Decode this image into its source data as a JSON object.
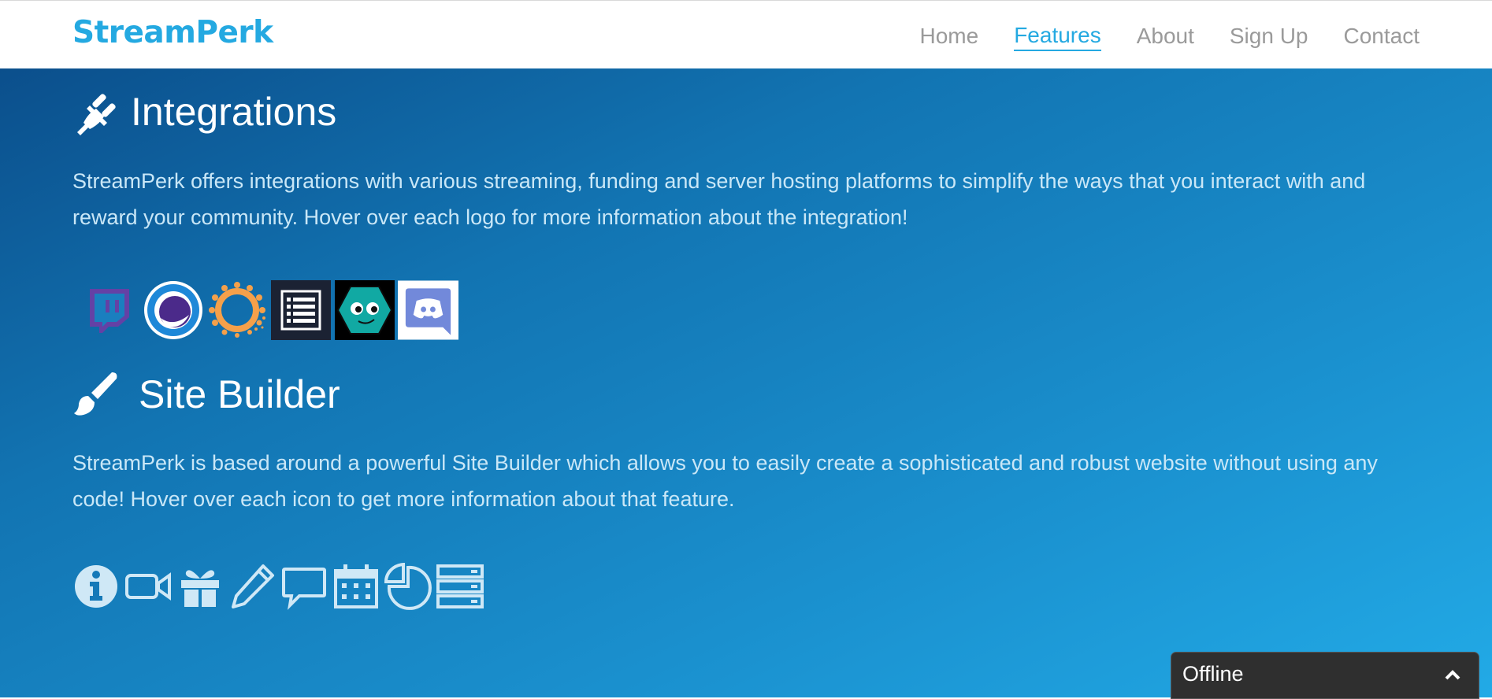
{
  "brand": "StreamPerk",
  "nav": {
    "items": [
      {
        "label": "Home"
      },
      {
        "label": "Features"
      },
      {
        "label": "About"
      },
      {
        "label": "Sign Up"
      },
      {
        "label": "Contact"
      }
    ],
    "active": "Features"
  },
  "integrations": {
    "title": "Integrations",
    "icon": "plug-icon",
    "text": "StreamPerk offers integrations with various streaming, funding and server hosting platforms to simplify the ways that you interact with and reward your community. Hover over each logo for more information about the integration!",
    "logos": [
      "twitch-logo",
      "streamelements-logo",
      "patreon-logo",
      "list-server-logo",
      "hexagon-bot-logo",
      "discord-logo"
    ]
  },
  "site_builder": {
    "title": "Site Builder",
    "icon": "paintbrush-icon",
    "text": "StreamPerk is based around a powerful Site Builder which allows you to easily create a sophisticated and robust website without using any code! Hover over each icon to get more information about that feature.",
    "feature_icons": [
      "info-icon",
      "video-camera-icon",
      "gift-icon",
      "pencil-icon",
      "chat-bubble-icon",
      "calendar-icon",
      "pie-chart-icon",
      "server-icon"
    ]
  },
  "chat_widget": {
    "status": "Offline",
    "icon": "chevron-up-icon"
  },
  "colors": {
    "brand": "#24a9e1",
    "nav_text": "#9a9a9a",
    "gradient_start": "#0b4f8c",
    "gradient_end": "#22aae6",
    "body_text": "#c9e7f7",
    "widget_bg": "#2f2f2f"
  }
}
